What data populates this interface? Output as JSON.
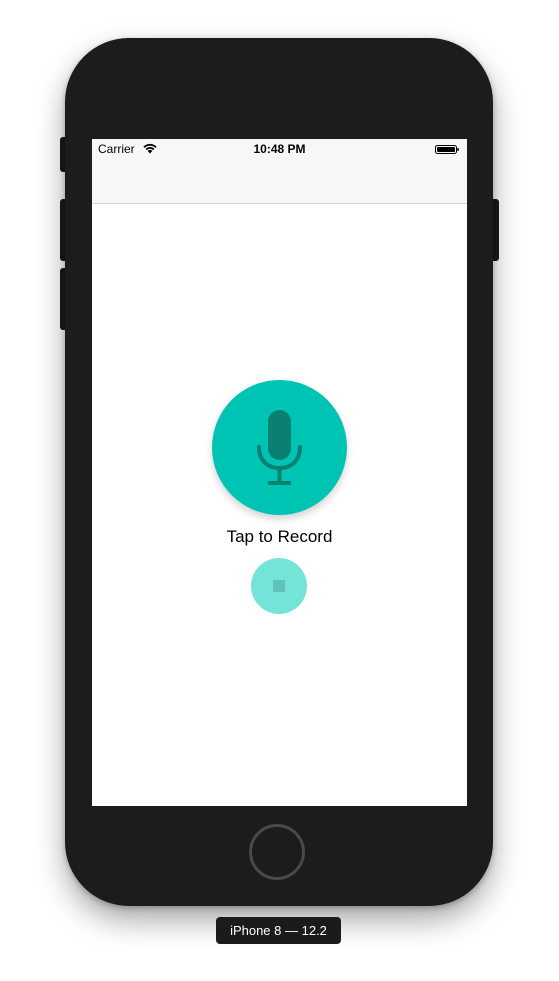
{
  "status_bar": {
    "carrier": "Carrier",
    "time": "10:48 PM",
    "wifi_icon": "wifi-icon",
    "battery_icon": "battery-full-icon"
  },
  "recorder": {
    "record_button_icon": "microphone-icon",
    "record_label": "Tap to Record",
    "stop_button_icon": "stop-icon",
    "accent_color": "#00c4b3",
    "stop_color": "#74e3d8"
  },
  "device": {
    "label": "iPhone 8 — 12.2"
  }
}
